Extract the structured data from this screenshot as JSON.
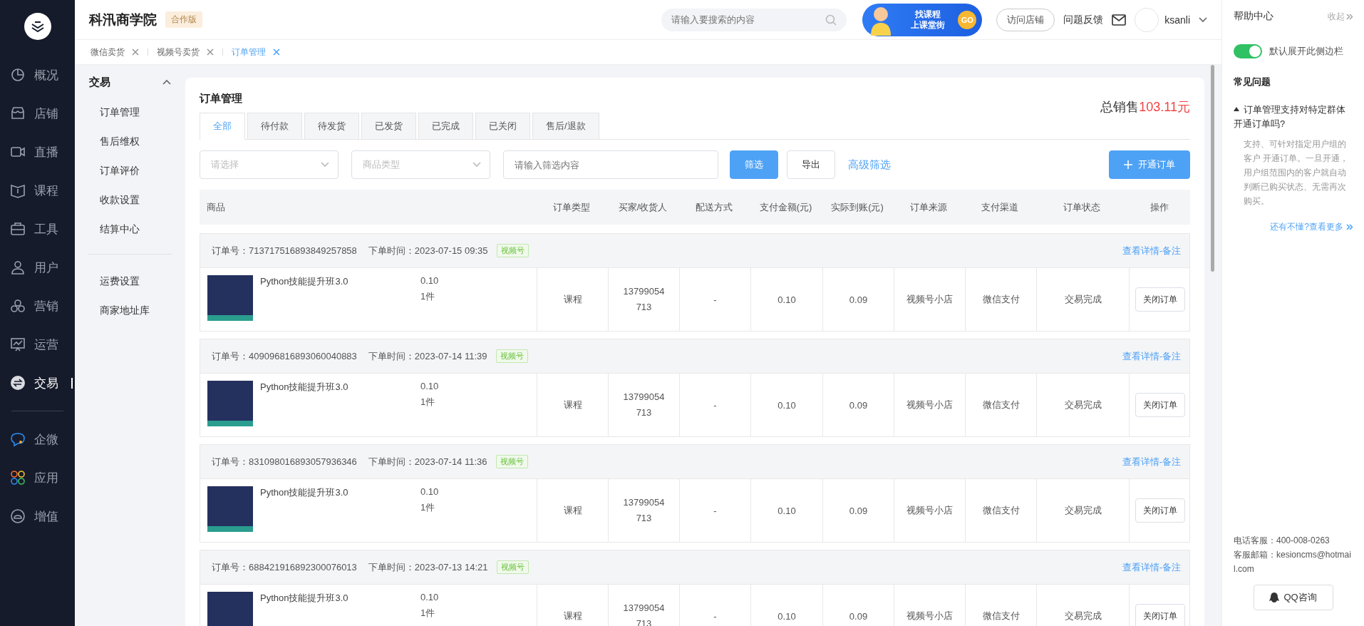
{
  "nav": [
    {
      "label": "概况",
      "selected": false
    },
    {
      "label": "店铺",
      "selected": false
    },
    {
      "label": "直播",
      "selected": false
    },
    {
      "label": "课程",
      "selected": false
    },
    {
      "label": "工具",
      "selected": false
    },
    {
      "label": "用户",
      "selected": false
    },
    {
      "label": "营销",
      "selected": false
    },
    {
      "label": "运营",
      "selected": false
    },
    {
      "label": "交易",
      "selected": true
    }
  ],
  "nav_apps": [
    {
      "label": "企微",
      "selected": false
    },
    {
      "label": "应用",
      "selected": false
    },
    {
      "label": "增值",
      "selected": false
    }
  ],
  "header": {
    "title": "科汛商学院",
    "badge": "合作版",
    "search": {
      "placeholder": "请输入要搜索的内容"
    },
    "banner": {
      "line1": "找课程",
      "line2": "上课堂街",
      "go": "GO"
    },
    "visit_button": "访问店铺",
    "feedback": "问题反馈",
    "username": "ksanli"
  },
  "page_tabs": [
    {
      "label": "微信卖货",
      "selected": false
    },
    {
      "label": "视频号卖货",
      "selected": false
    },
    {
      "label": "订单管理",
      "selected": true
    }
  ],
  "subnav": {
    "title": "交易",
    "expanded": true,
    "groups": [
      [
        "订单管理",
        "售后维权",
        "订单评价",
        "收款设置",
        "结算中心"
      ],
      [
        "运费设置",
        "商家地址库"
      ]
    ]
  },
  "main": {
    "title": "订单管理",
    "total_label": "总销售",
    "total_value": "103.11元",
    "tabs": [
      {
        "label": "全部",
        "selected": true
      },
      {
        "label": "待付款",
        "selected": false
      },
      {
        "label": "待发货",
        "selected": false
      },
      {
        "label": "已发货",
        "selected": false
      },
      {
        "label": "已完成",
        "selected": false
      },
      {
        "label": "已关闭",
        "selected": false
      },
      {
        "label": "售后/退款",
        "selected": false
      }
    ],
    "filters": {
      "select_1": "请选择",
      "select_2": "商品类型",
      "input": {
        "placeholder": "请输入筛选内容"
      },
      "filter_button": "筛选",
      "export_button": "导出",
      "advanced": "高级筛选",
      "new_order": "开通订单"
    },
    "columns": [
      "商品",
      "订单类型",
      "买家/收货人",
      "配送方式",
      "支付金额(元)",
      "实际到账(元)",
      "订单来源",
      "支付渠道",
      "订单状态",
      "操作"
    ],
    "orders": [
      {
        "order_no": "订单号：713717516893849257858",
        "time": "下单时间：2023-07-15 09:35",
        "tag": "视频号",
        "detail_link": "查看详情-备注",
        "product": "Python技能提升班3.0",
        "price": "0.10",
        "qty": "1件",
        "type": "课程",
        "buyer": "13799054713",
        "delivery": "-",
        "paid": "0.10",
        "received": "0.09",
        "source": "视频号小店",
        "channel": "微信支付",
        "status": "交易完成",
        "action": "关闭订单"
      },
      {
        "order_no": "订单号：409096816893060040883",
        "time": "下单时间：2023-07-14 11:39",
        "tag": "视频号",
        "detail_link": "查看详情-备注",
        "product": "Python技能提升班3.0",
        "price": "0.10",
        "qty": "1件",
        "type": "课程",
        "buyer": "13799054713",
        "delivery": "-",
        "paid": "0.10",
        "received": "0.09",
        "source": "视频号小店",
        "channel": "微信支付",
        "status": "交易完成",
        "action": "关闭订单"
      },
      {
        "order_no": "订单号：831098016893057936346",
        "time": "下单时间：2023-07-14 11:36",
        "tag": "视频号",
        "detail_link": "查看详情-备注",
        "product": "Python技能提升班3.0",
        "price": "0.10",
        "qty": "1件",
        "type": "课程",
        "buyer": "13799054713",
        "delivery": "-",
        "paid": "0.10",
        "received": "0.09",
        "source": "视频号小店",
        "channel": "微信支付",
        "status": "交易完成",
        "action": "关闭订单"
      },
      {
        "order_no": "订单号：688421916892300076013",
        "time": "下单时间：2023-07-13 14:21",
        "tag": "视频号",
        "detail_link": "查看详情-备注",
        "product": "Python技能提升班3.0",
        "price": "0.10",
        "qty": "1件",
        "type": "课程",
        "buyer": "13799054713",
        "delivery": "-",
        "paid": "0.10",
        "received": "0.09",
        "source": "视频号小店",
        "channel": "微信支付",
        "status": "交易完成",
        "action": "关闭订单"
      }
    ]
  },
  "help": {
    "title": "帮助中心",
    "collapse": "收起",
    "toggle": {
      "label": "默认展开此侧边栏",
      "on": true
    },
    "faq_title": "常见问题",
    "faq": [
      {
        "question": "订单管理支持对特定群体开通订单吗?",
        "answer": "支持、可针对指定用户组的客户 开通订单。一旦开通，用户组范围内的客户就自动判断已购买状态、无需再次购买。",
        "expanded": true
      }
    ],
    "more_link": "还有不懂?查看更多",
    "phone": "电话客服：400-008-0263",
    "email": "客服邮箱：kesioncms@hotmail.com",
    "qq_button": "QQ咨询"
  }
}
